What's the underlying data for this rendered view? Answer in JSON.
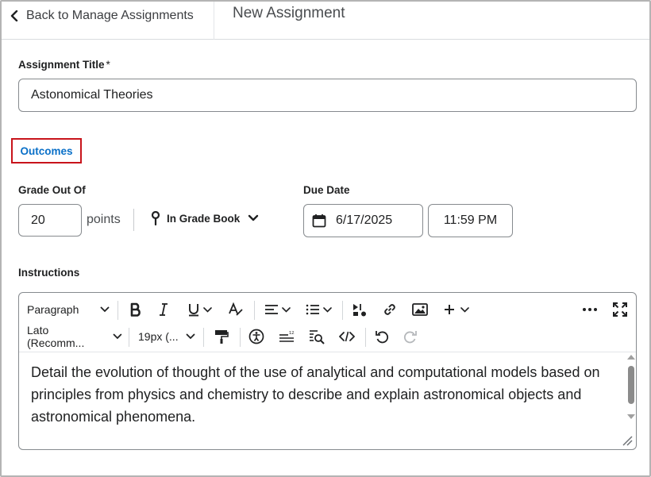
{
  "header": {
    "back_label": "Back to Manage Assignments",
    "page_title": "New Assignment"
  },
  "form": {
    "title_label": "Assignment Title",
    "required_mark": "*",
    "title_value": "Astonomical Theories",
    "outcomes_label": "Outcomes",
    "grade_label": "Grade Out Of",
    "grade_value": "20",
    "points_label": "points",
    "gradebook_label": "In Grade Book",
    "due_label": "Due Date",
    "due_date": "6/17/2025",
    "due_time": "11:59 PM",
    "instructions_label": "Instructions"
  },
  "editor": {
    "format_label": "Paragraph",
    "font_label": "Lato (Recomm...",
    "size_label": "19px (...",
    "content": "Detail the evolution of thought of the use of analytical and computational models based on principles from physics and chemistry to describe and explain astronomical objects and astronomical phenomena."
  },
  "colors": {
    "link": "#0a70c8",
    "highlight_border": "#c8141b",
    "input_border": "#868a8e"
  }
}
